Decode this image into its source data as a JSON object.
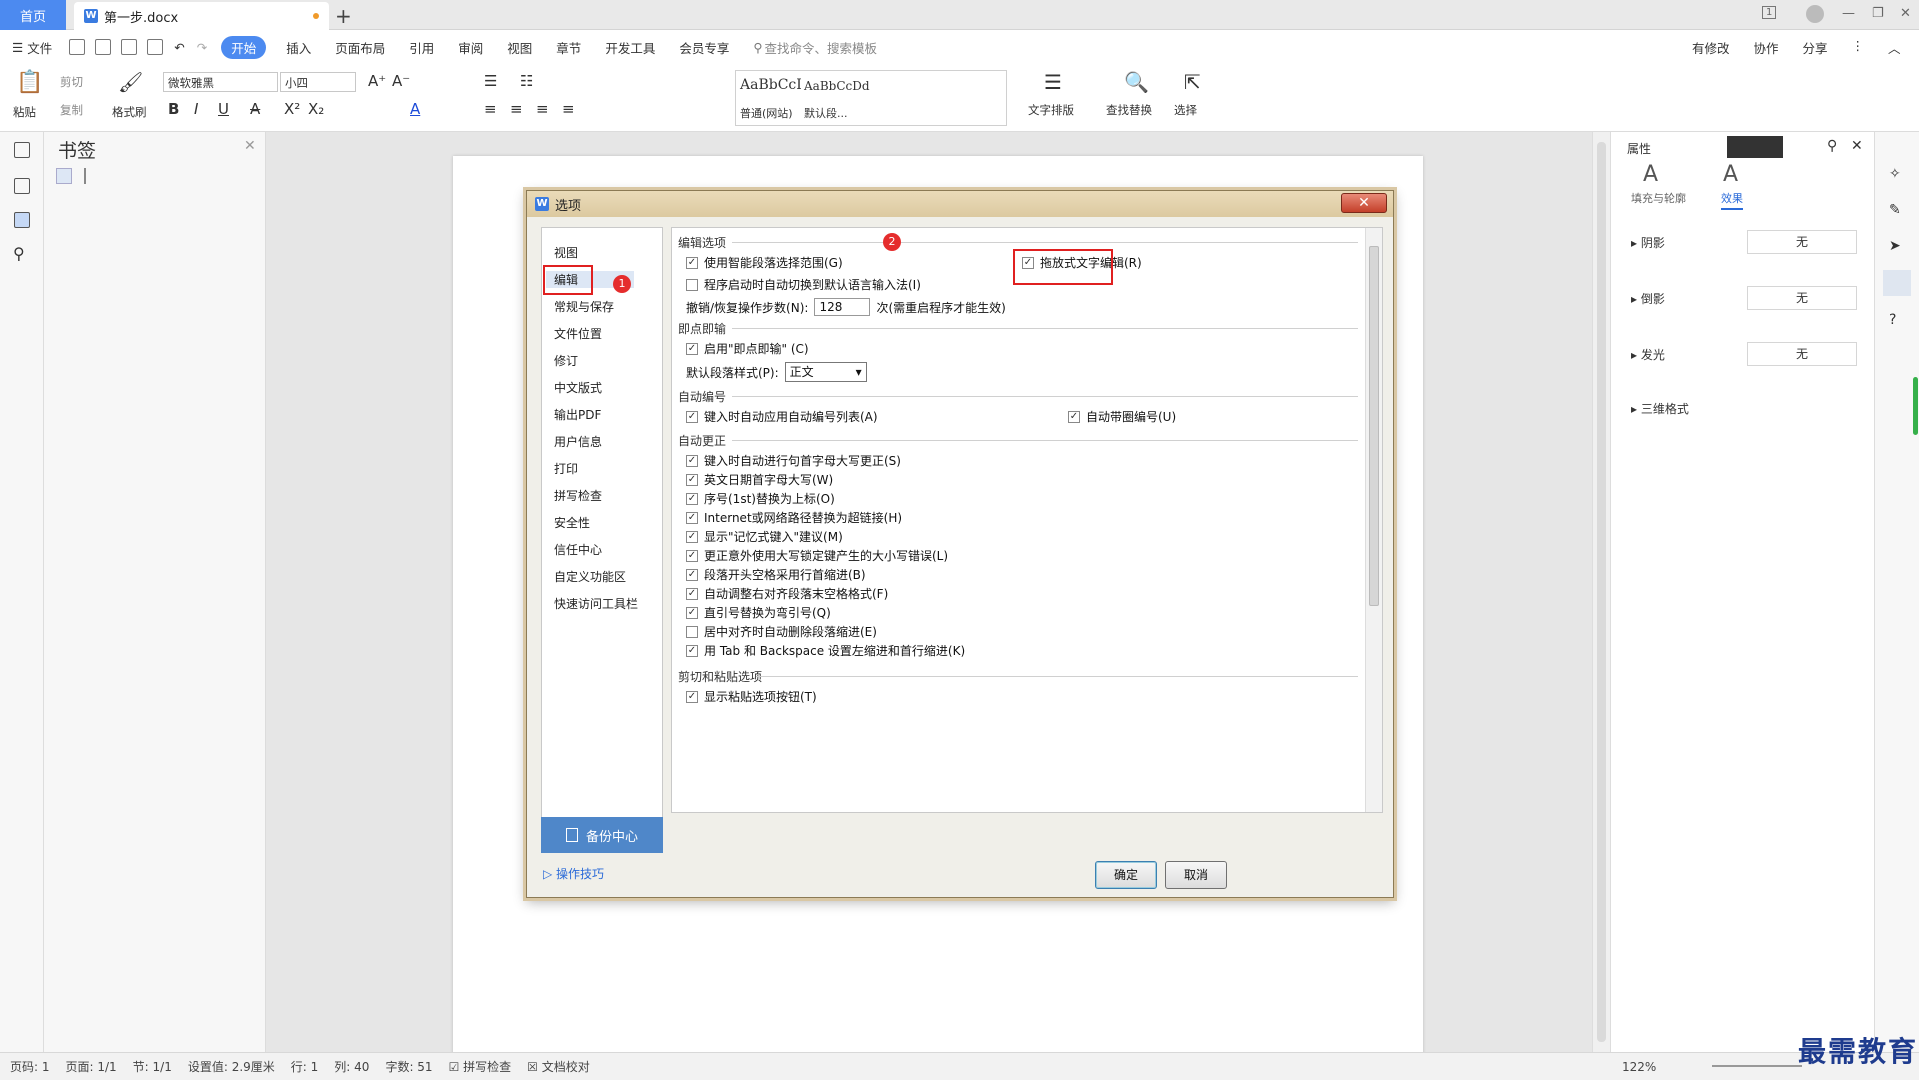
{
  "tabbar": {
    "home": "首页",
    "doc": "第一步.docx",
    "badge_count": "1"
  },
  "menu": {
    "file": "文件",
    "items": [
      "开始",
      "插入",
      "页面布局",
      "引用",
      "审阅",
      "视图",
      "章节",
      "开发工具",
      "会员专享"
    ],
    "search": "查找命令、搜索模板",
    "modified": "有修改",
    "collab": "协作",
    "share": "分享"
  },
  "ribbon": {
    "paste": "粘贴",
    "cut": "剪切",
    "copy": "复制",
    "format_painter": "格式刷",
    "font": "微软雅黑",
    "size": "小四",
    "style1_preview": "AaBbCcI",
    "style1_name": "普通(网站)",
    "style2_preview": "AaBbCcDd",
    "style2_name": "默认段...",
    "text_layout": "文字排版",
    "find_replace": "查找替换",
    "select": "选择"
  },
  "bookmark": {
    "title": "书签"
  },
  "right_panel": {
    "tab_label": "属性",
    "fill": "填充与轮廓",
    "effect": "效果",
    "rows": [
      {
        "label": "阴影",
        "value": "无"
      },
      {
        "label": "倒影",
        "value": "无"
      },
      {
        "label": "发光",
        "value": "无"
      },
      {
        "label": "三维格式",
        "value": ""
      }
    ]
  },
  "dialog": {
    "title": "选项",
    "nav": [
      "视图",
      "编辑",
      "常规与保存",
      "文件位置",
      "修订",
      "中文版式",
      "输出PDF",
      "用户信息",
      "打印",
      "拼写检查",
      "安全性",
      "信任中心",
      "自定义功能区",
      "快速访问工具栏"
    ],
    "backup": "备份中心",
    "tips": "操作技巧",
    "ok": "确定",
    "cancel": "取消",
    "sections": {
      "edit": "编辑选项",
      "click_type": "即点即输",
      "auto_number": "自动编号",
      "auto_correct": "自动更正",
      "cut_paste": "剪切和粘贴选项"
    },
    "edit_options": {
      "smart_select": "使用智能段落选择范围(G)",
      "auto_ime": "程序启动时自动切换到默认语言输入法(I)",
      "drag_edit": "拖放式文字编辑(R)",
      "undo_label": "撤销/恢复操作步数(N):",
      "undo_value": "128",
      "undo_hint": "次(需重启程序才能生效)"
    },
    "click_type_opts": {
      "enable": "启用\"即点即输\" (C)",
      "style_label": "默认段落样式(P):",
      "style_value": "正文"
    },
    "auto_number_opts": {
      "list": "键入时自动应用自动编号列表(A)",
      "circle": "自动带圈编号(U)"
    },
    "auto_correct_opts": [
      {
        "label": "键入时自动进行句首字母大写更正(S)",
        "checked": true
      },
      {
        "label": "英文日期首字母大写(W)",
        "checked": true
      },
      {
        "label": "序号(1st)替换为上标(O)",
        "checked": true
      },
      {
        "label": "Internet或网络路径替换为超链接(H)",
        "checked": true
      },
      {
        "label": "显示\"记忆式键入\"建议(M)",
        "checked": true
      },
      {
        "label": "更正意外使用大写锁定键产生的大小写错误(L)",
        "checked": true
      },
      {
        "label": "段落开头空格采用行首缩进(B)",
        "checked": true
      },
      {
        "label": "自动调整右对齐段落末空格格式(F)",
        "checked": true
      },
      {
        "label": "直引号替换为弯引号(Q)",
        "checked": true
      },
      {
        "label": "居中对齐时自动删除段落缩进(E)",
        "checked": false
      },
      {
        "label": "用 Tab 和 Backspace 设置左缩进和首行缩进(K)",
        "checked": true
      }
    ],
    "cut_paste_opts": {
      "show_btn": "显示粘贴选项按钮(T)"
    },
    "badges": [
      "1",
      "2"
    ]
  },
  "status": {
    "page": "页码: 1",
    "pages": "页面: 1/1",
    "section": "节: 1/1",
    "setting": "设置值: 2.9厘米",
    "row": "行: 1",
    "col": "列: 40",
    "words": "字数: 51",
    "spell": "拼写检查",
    "proof": "文档校对",
    "zoom": "122%"
  },
  "watermark": "最需教育"
}
